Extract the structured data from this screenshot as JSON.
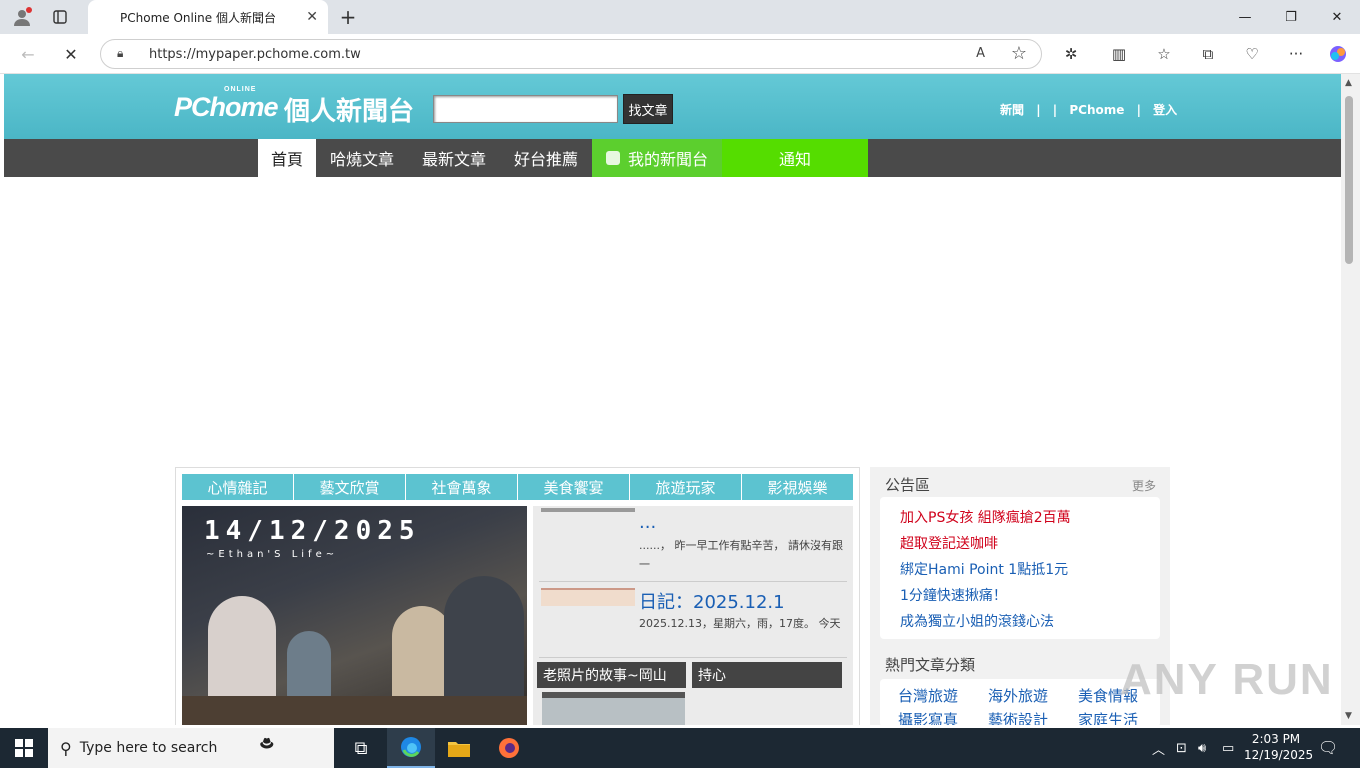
{
  "browser": {
    "tab_title": "PChome Online 個人新聞台",
    "url": "https://mypaper.pchome.com.tw"
  },
  "site": {
    "logo_text": "PChome",
    "logo_small": "ONLINE",
    "logo_cn": "個人新聞台",
    "search_placeholder": "",
    "search_button": "找文章",
    "top_links": [
      "新聞",
      "|",
      "|",
      "PChome",
      "|",
      "登入"
    ]
  },
  "nav": {
    "items": [
      "首頁",
      "哈燒文章",
      "最新文章",
      "好台推薦",
      "我的新聞台",
      "通知"
    ]
  },
  "categories": [
    "心情雜記",
    "藝文欣賞",
    "社會萬象",
    "美食饗宴",
    "旅遊玩家",
    "影視娛樂"
  ],
  "feature": {
    "date": "14/12/2025",
    "subtitle": "~Ethan'S Life~"
  },
  "list": [
    {
      "title": "...",
      "desc": "......， 昨一早工作有點辛苦， 請休沒有跟一"
    },
    {
      "title": "日記：2025.12.1",
      "desc": "2025.12.13，星期六，雨，17度。 今天"
    }
  ],
  "pills": [
    "老照片的故事~岡山",
    "持心"
  ],
  "sidebar": {
    "announce_title": "公告區",
    "more": "更多",
    "announcements": [
      {
        "text": "加入PS女孩 組隊瘋搶2百萬",
        "color": "#d0021b"
      },
      {
        "text": "超取登記送咖啡",
        "color": "#d0021b"
      },
      {
        "text": "綁定Hami Point 1點抵1元",
        "color": "#1a5fb4"
      },
      {
        "text": "1分鐘快速揪痛！",
        "color": "#1a5fb4"
      },
      {
        "text": "成為獨立小姐的滾錢心法",
        "color": "#1a5fb4"
      }
    ],
    "hot_title": "熱門文章分類",
    "hot_categories": [
      "台灣旅遊",
      "海外旅遊",
      "美食情報",
      "攝影寫真",
      "藝術設計",
      "家庭生活"
    ]
  },
  "taskbar": {
    "search_text": "Type here to search",
    "time": "2:03 PM",
    "date": "12/19/2025"
  },
  "watermark": "ANY RUN",
  "colors": {
    "header": "#4bb6c6",
    "nav_bg": "#4a4a4a",
    "green": "#5ccf2e",
    "link_blue": "#1a5fb4",
    "link_red": "#d0021b"
  }
}
